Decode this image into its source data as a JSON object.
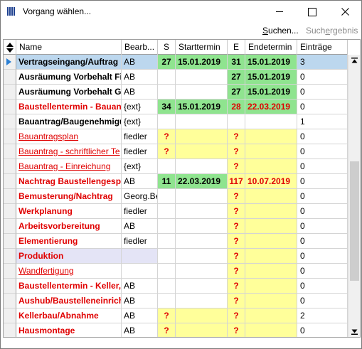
{
  "window": {
    "title": "Vorgang wählen...",
    "icons": {
      "app": "app-grid-icon",
      "minimize": "minimize-icon",
      "maximize": "maximize-icon",
      "close": "close-icon"
    }
  },
  "toolbar": {
    "search_prefix": "",
    "search_mnemonic": "S",
    "search_rest": "uchen...",
    "results_prefix": "Such",
    "results_mnemonic": "e",
    "results_rest": "rgebnis"
  },
  "columns": {
    "sort_icon": "sort-updown-icon",
    "name": "Name",
    "bearb": "Bearb...",
    "s": "S",
    "start": "Starttermin",
    "e": "E",
    "end": "Endetermin",
    "count": "Einträge"
  },
  "colors": {
    "accent_green": "#8fe48f",
    "accent_yellow": "#ffff9a",
    "accent_red": "#e00000",
    "selection": "#bcd7ee"
  },
  "rows": [
    {
      "name": "Vertragseingang/Auftrag",
      "bearb": "AB",
      "s": "27",
      "start": "15.01.2019",
      "e": "31",
      "end": "15.01.2019",
      "count": "3",
      "style": "bold",
      "selected": true,
      "sfill": "green",
      "efill": "green"
    },
    {
      "name": "Ausräumung Vorbehalt Fi",
      "bearb": "AB",
      "s": "",
      "start": "",
      "e": "27",
      "end": "15.01.2019",
      "count": "0",
      "style": "bold",
      "sfill": "",
      "efill": "green"
    },
    {
      "name": "Ausräumung Vorbehalt G",
      "bearb": "AB",
      "s": "",
      "start": "",
      "e": "27",
      "end": "15.01.2019",
      "count": "0",
      "style": "bold",
      "sfill": "",
      "efill": "green"
    },
    {
      "name": "Baustellentermin - Bauan",
      "bearb": "{ext}",
      "s": "34",
      "start": "15.01.2019",
      "e": "28",
      "end": "22.03.2019",
      "count": "0",
      "style": "bold-red",
      "sfill": "green",
      "efill": "green-red"
    },
    {
      "name": "Bauantrag/Baugenehmigu",
      "bearb": "{ext}",
      "s": "",
      "start": "",
      "e": "",
      "end": "",
      "count": "1",
      "style": "bold",
      "sfill": "",
      "efill": ""
    },
    {
      "name": "Bauantragsplan",
      "bearb": "fiedler",
      "s": "?",
      "start": "",
      "e": "?",
      "end": "",
      "count": "0",
      "style": "link-red",
      "sfill": "yellow",
      "efill": "yellow"
    },
    {
      "name": "Bauantrag - schriftlicher Te",
      "bearb": "fiedler",
      "s": "?",
      "start": "",
      "e": "?",
      "end": "",
      "count": "0",
      "style": "link-red",
      "sfill": "yellow",
      "efill": "yellow"
    },
    {
      "name": "Bauantrag - Einreichung",
      "bearb": "{ext}",
      "s": "",
      "start": "",
      "e": "?",
      "end": "",
      "count": "0",
      "style": "link-red",
      "sfill": "",
      "efill": "yellow"
    },
    {
      "name": "Nachtrag Baustellengespr",
      "bearb": "AB",
      "s": "11",
      "start": "22.03.2019",
      "e": "117",
      "end": "10.07.2019",
      "count": "0",
      "style": "bold-red",
      "sfill": "green",
      "efill": "yellow-red"
    },
    {
      "name": "Bemusterung/Nachtrag",
      "bearb": "Georg.Be",
      "s": "",
      "start": "",
      "e": "?",
      "end": "",
      "count": "0",
      "style": "bold-red",
      "sfill": "",
      "efill": "yellow"
    },
    {
      "name": "Werkplanung",
      "bearb": "fiedler",
      "s": "",
      "start": "",
      "e": "?",
      "end": "",
      "count": "0",
      "style": "bold-red",
      "sfill": "",
      "efill": "yellow"
    },
    {
      "name": "Arbeitsvorbereitung",
      "bearb": "AB",
      "s": "",
      "start": "",
      "e": "?",
      "end": "",
      "count": "0",
      "style": "bold-red",
      "sfill": "",
      "efill": "yellow"
    },
    {
      "name": "Elementierung",
      "bearb": "fiedler",
      "s": "",
      "start": "",
      "e": "?",
      "end": "",
      "count": "0",
      "style": "bold-red",
      "sfill": "",
      "efill": "yellow"
    },
    {
      "name": "Produktion",
      "bearb": "",
      "s": "",
      "start": "",
      "e": "?",
      "end": "",
      "count": "0",
      "style": "bold-red",
      "lavender": true,
      "sfill": "",
      "efill": "yellow"
    },
    {
      "name": "Wandfertigung",
      "bearb": "",
      "s": "",
      "start": "",
      "e": "?",
      "end": "",
      "count": "0",
      "style": "link-red",
      "sfill": "",
      "efill": "yellow"
    },
    {
      "name": "Baustellentermin - Keller,",
      "bearb": "AB",
      "s": "",
      "start": "",
      "e": "?",
      "end": "",
      "count": "0",
      "style": "bold-red",
      "sfill": "",
      "efill": "yellow"
    },
    {
      "name": "Aushub/Baustelleneinrich",
      "bearb": "AB",
      "s": "",
      "start": "",
      "e": "?",
      "end": "",
      "count": "0",
      "style": "bold-red",
      "sfill": "",
      "efill": "yellow"
    },
    {
      "name": "Kellerbau/Abnahme",
      "bearb": "AB",
      "s": "?",
      "start": "",
      "e": "?",
      "end": "",
      "count": "2",
      "style": "bold-red",
      "sfill": "yellow",
      "efill": "yellow"
    },
    {
      "name": "Hausmontage",
      "bearb": "AB",
      "s": "?",
      "start": "",
      "e": "?",
      "end": "",
      "count": "0",
      "style": "bold-red",
      "sfill": "yellow",
      "efill": "yellow"
    }
  ],
  "scrollbar": {
    "up_icon": "scroll-up-icon",
    "down_icon": "scroll-down-icon"
  }
}
